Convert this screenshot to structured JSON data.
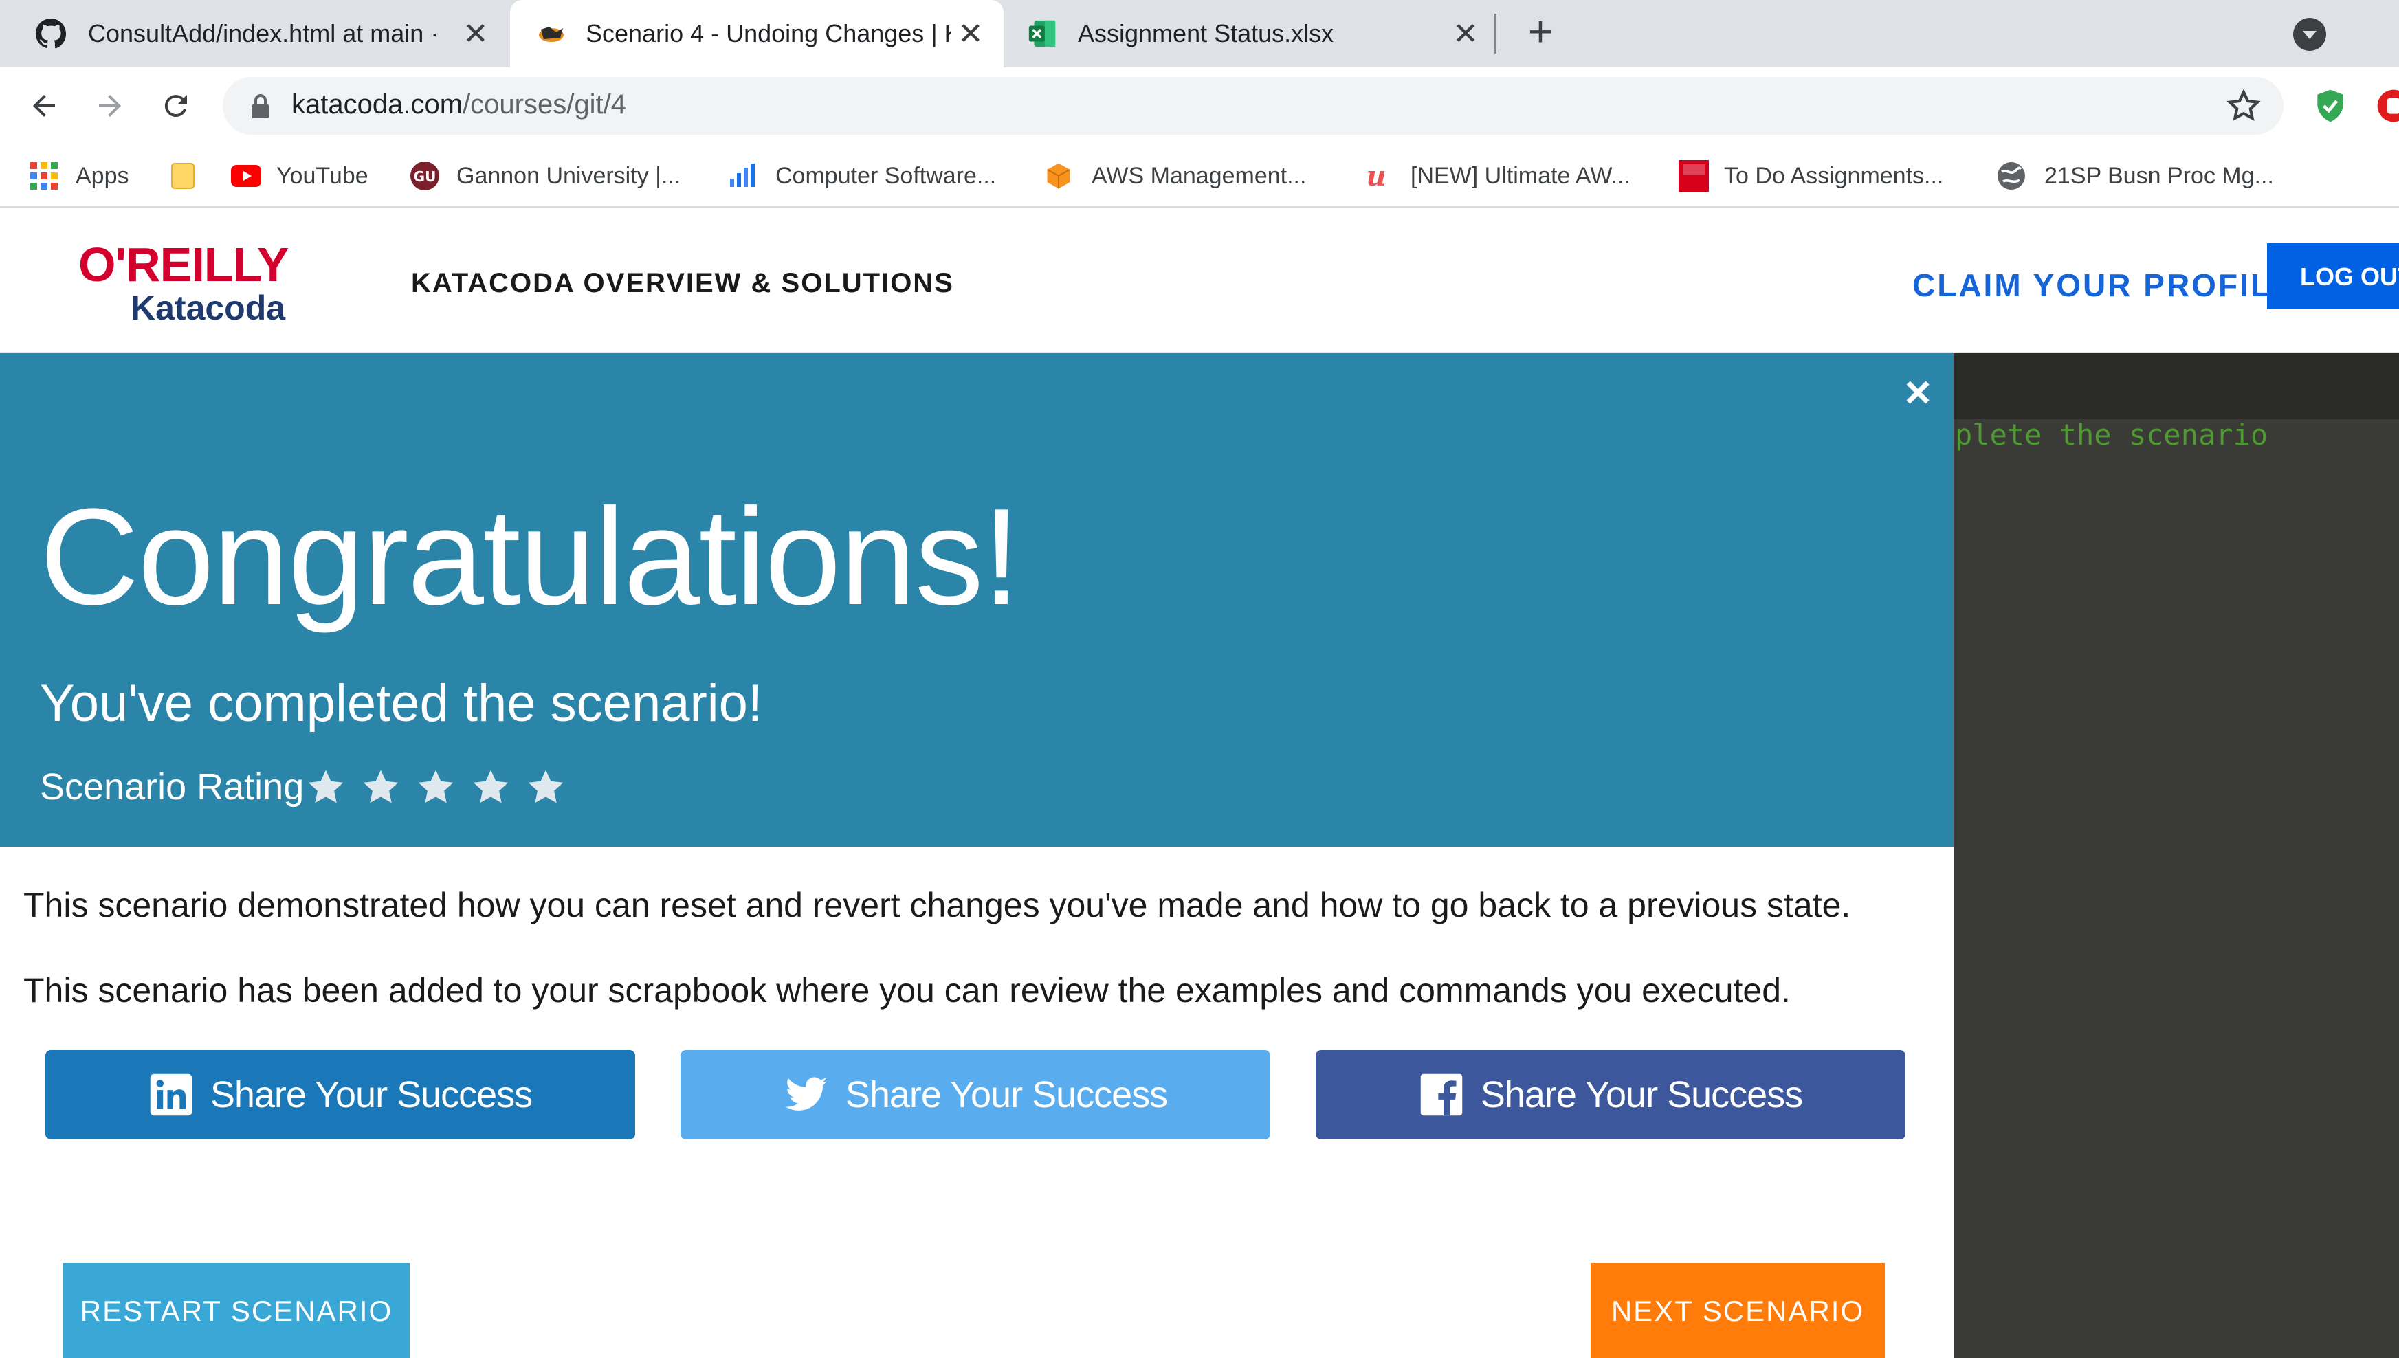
{
  "browser": {
    "tabs": [
      {
        "title": "ConsultAdd/index.html at main ·",
        "icon": "github-icon",
        "active": false
      },
      {
        "title": "Scenario 4 - Undoing Changes | K",
        "icon": "katacoda-icon",
        "active": true
      },
      {
        "title": "Assignment Status.xlsx",
        "icon": "excel-icon",
        "active": false
      }
    ],
    "new_tab": "+",
    "url_domain": "katacoda.com",
    "url_path": "/courses/git/4",
    "bookmarks": [
      {
        "label": "Apps",
        "icon": "apps-grid-icon"
      },
      {
        "label": "",
        "icon": "folder-icon"
      },
      {
        "label": "YouTube",
        "icon": "youtube-icon"
      },
      {
        "label": "Gannon University |...",
        "icon": "gannon-icon"
      },
      {
        "label": "Computer Software...",
        "icon": "chart-icon"
      },
      {
        "label": "AWS Management...",
        "icon": "aws-icon"
      },
      {
        "label": "[NEW] Ultimate AW...",
        "icon": "udemy-icon"
      },
      {
        "label": "To Do Assignments...",
        "icon": "mcgraw-hill-icon"
      },
      {
        "label": "21SP Busn Proc Mg...",
        "icon": "globe-icon"
      }
    ]
  },
  "site": {
    "logo_top": "O'REILLY",
    "logo_bottom": "Katacoda",
    "nav_overview": "KATACODA OVERVIEW & SOLUTIONS",
    "claim_profile": "CLAIM YOUR PROFILE",
    "log_out": "LOG OUT"
  },
  "terminal": {
    "text": "plete the scenario"
  },
  "modal": {
    "close": "×",
    "heading": "Congratulations!",
    "subheading": "You've completed the scenario!",
    "rating_label": "Scenario Rating",
    "rating_max": 5,
    "description_1": "This scenario demonstrated how you can reset and revert changes you've made and how to go back to a previous state.",
    "description_2": "This scenario has been added to your scrapbook where you can review the examples and commands you executed.",
    "share_buttons": [
      {
        "label": "Share Your Success",
        "network": "linkedin",
        "color": "#1a78b9"
      },
      {
        "label": "Share Your Success",
        "network": "twitter",
        "color": "#59adee"
      },
      {
        "label": "Share Your Success",
        "network": "facebook",
        "color": "#3c579c"
      }
    ],
    "restart_button": "RESTART SCENARIO",
    "next_button": "NEXT SCENARIO"
  },
  "colors": {
    "banner": "#2a85a8",
    "restart": "#3aa8d6",
    "next": "#ff7c0a",
    "claim": "#1565d8",
    "logout": "#0062e3"
  }
}
